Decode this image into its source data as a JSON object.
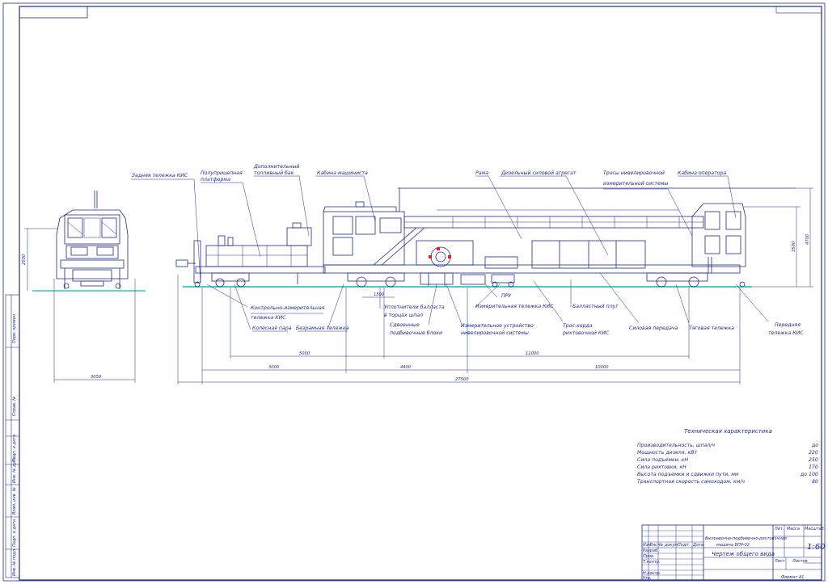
{
  "title_block": {
    "machine_name_line1": "Выправочно-подбивочно-рихтовочная",
    "machine_name_line2": "машина ВПР-02",
    "drawing_title": "Чертеж общего вида",
    "scale": "1:60",
    "hdr_izm": "Изм.",
    "hdr_list": "Лист",
    "hdr_doc": "№ докум.",
    "hdr_sign": "Подп.",
    "hdr_date": "Дата",
    "role_razrab": "Разраб.",
    "role_prov": "Пров.",
    "role_tkontr": "Т.контр.",
    "role_nkontr": "Н.контр.",
    "role_utv": "Утв.",
    "hdr_lit": "Лит.",
    "hdr_massa": "Масса",
    "hdr_masshtab": "Масштаб",
    "hdr_sheet": "Лист",
    "hdr_sheets": "Листов",
    "format": "Формат А1"
  },
  "specs": {
    "heading": "Техническая характеристика",
    "items": [
      {
        "label": "Производительность, шпал/ч",
        "value": "до"
      },
      {
        "label": "Мощность дизеля, кВт",
        "value": "220"
      },
      {
        "label": "Сила подъемки, кН",
        "value": "250"
      },
      {
        "label": "Сила рихтовки, кН",
        "value": "170"
      },
      {
        "label": "Высота подъемки и сдвижки пути, мм",
        "value": "до 100"
      },
      {
        "label": "Транспортная скорость самоходом, км/ч",
        "value": "80"
      }
    ]
  },
  "callouts_top": {
    "rear_bogie": "Задняя тележка КИС",
    "platform_line1": "Полуприцепная",
    "platform_line2": "платформа",
    "fuel_line1": "Дополнительный",
    "fuel_line2": "топливный бак",
    "cabin": "Кабина машиниста",
    "frame": "Рама",
    "power_unit": "Дизельный силовой агрегат",
    "cables_line1": "Тросы нивелировочной",
    "cables_line2": "измерительной системы",
    "operator_cabin": "Кабина оператора"
  },
  "callouts_bottom": {
    "control_bogie_line1": "Контрольно-измерительная",
    "control_bogie_line2": "тележка КИС",
    "wheelset": "Колесная пара",
    "bogie_bezpivot": "Безрамная тележка",
    "compactor_line1": "Уплотнители балласта",
    "compactor_line2": "в торцах шпал",
    "tamping_line1": "Сдвоенные",
    "tamping_line2": "подбивочные блоки",
    "leveling_line1": "Измерительное устройство",
    "leveling_line2": "нивелировочной системы",
    "pru": "ПРУ",
    "measuring_bogie": "Измерительная тележка КИС",
    "chord_line1": "Трос-хорда",
    "chord_line2": "рихтовочной КИС",
    "ballast_plough": "Балластный плуг",
    "power_transmission": "Силовая передача",
    "drive_bogie": "Тяговая тележка",
    "front_bogie_line1": "Передняя",
    "front_bogie_line2": "тележка КИС"
  },
  "dimensions": {
    "d_5000": "5000",
    "d_3000": "3000",
    "d_4400": "4400",
    "d_11000": "11000",
    "d_10000": "10000",
    "d_total": "27500",
    "d_1500": "1500",
    "h_4700": "4700",
    "h_3500": "3500",
    "front_width": "3050",
    "front_height": "2500"
  },
  "stamps": {
    "inv_podl": "Инв. № подл.",
    "podp_data": "Подп. и дата",
    "vzam_inv": "Взам. инв. №",
    "inv_dubl": "Инв. № дубл.",
    "podp_data2": "Подп. и дата",
    "sprav": "Справ. №",
    "perv_prim": "Перв. примен."
  },
  "colors": {
    "line": "#1f2a8a",
    "rail": "#17b3b3",
    "marker": "#e0202a"
  }
}
